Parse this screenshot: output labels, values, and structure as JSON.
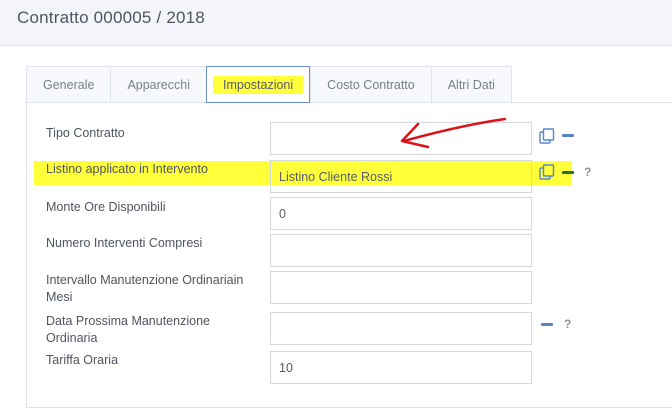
{
  "header": {
    "title": "Contratto 000005 / 2018"
  },
  "tabs": [
    {
      "label": "Generale",
      "active": false
    },
    {
      "label": "Apparecchi",
      "active": false
    },
    {
      "label": "Impostazioni",
      "active": true
    },
    {
      "label": "Costo Contratto",
      "active": false
    },
    {
      "label": "Altri Dati",
      "active": false
    }
  ],
  "form": {
    "tipo_contratto": {
      "label": "Tipo Contratto",
      "value": ""
    },
    "listino": {
      "label": "Listino applicato in Intervento",
      "value": "Listino Cliente Rossi"
    },
    "monte_ore": {
      "label": "Monte Ore Disponibili",
      "value": "0"
    },
    "numero_interventi": {
      "label": "Numero Interventi Compresi",
      "value": ""
    },
    "intervallo": {
      "label": "Intervallo Manutenzione Ordinariain Mesi",
      "value": ""
    },
    "data_prossima": {
      "label": "Data Prossima Manutenzione Ordinaria",
      "value": ""
    },
    "tariffa": {
      "label": "Tariffa Oraria",
      "value": "10"
    }
  },
  "help_glyph": "?",
  "colors": {
    "accent": "#5a83c8",
    "highlight": "#ffff3a",
    "annotation_arrow": "#d9141a"
  },
  "icons": [
    "copy-icon",
    "minus-icon",
    "help-icon",
    "annotation-arrow"
  ]
}
